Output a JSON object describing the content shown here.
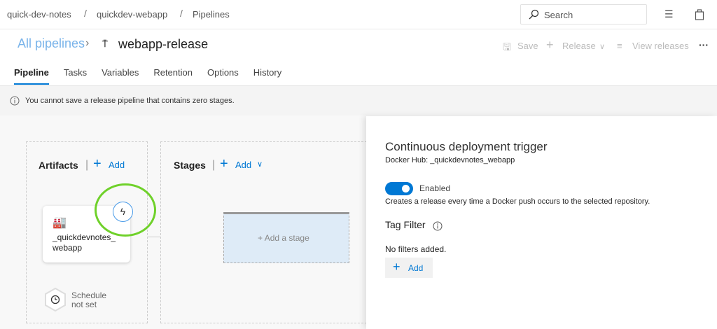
{
  "breadcrumb": [
    "quick-dev-notes",
    "quickdev-webapp",
    "Pipelines"
  ],
  "search": {
    "placeholder": "Search"
  },
  "header": {
    "back_link": "All pipelines",
    "title": "webapp-release"
  },
  "toolbar": {
    "save": "Save",
    "release": "Release",
    "view_releases": "View releases",
    "more": "···"
  },
  "tabs": [
    "Pipeline",
    "Tasks",
    "Variables",
    "Retention",
    "Options",
    "History"
  ],
  "info_message": "You cannot save a release pipeline that contains zero stages.",
  "artifacts": {
    "title": "Artifacts",
    "add": "Add",
    "artifact_name_1": "_quickdevnotes_",
    "artifact_name_2": "webapp",
    "schedule_1": "Schedule",
    "schedule_2": "not set"
  },
  "stages": {
    "title": "Stages",
    "add": "Add",
    "add_stage": "Add a stage"
  },
  "panel": {
    "title": "Continuous deployment trigger",
    "subtitle": "Docker Hub: _quickdevnotes_webapp",
    "toggle_label": "Enabled",
    "toggle_on": true,
    "description": "Creates a release every time a Docker push occurs to the selected repository.",
    "tag_filter": "Tag Filter",
    "no_filters": "No filters added.",
    "add": "Add"
  },
  "colors": {
    "accent": "#0078d4",
    "highlight": "#6fd12a"
  }
}
